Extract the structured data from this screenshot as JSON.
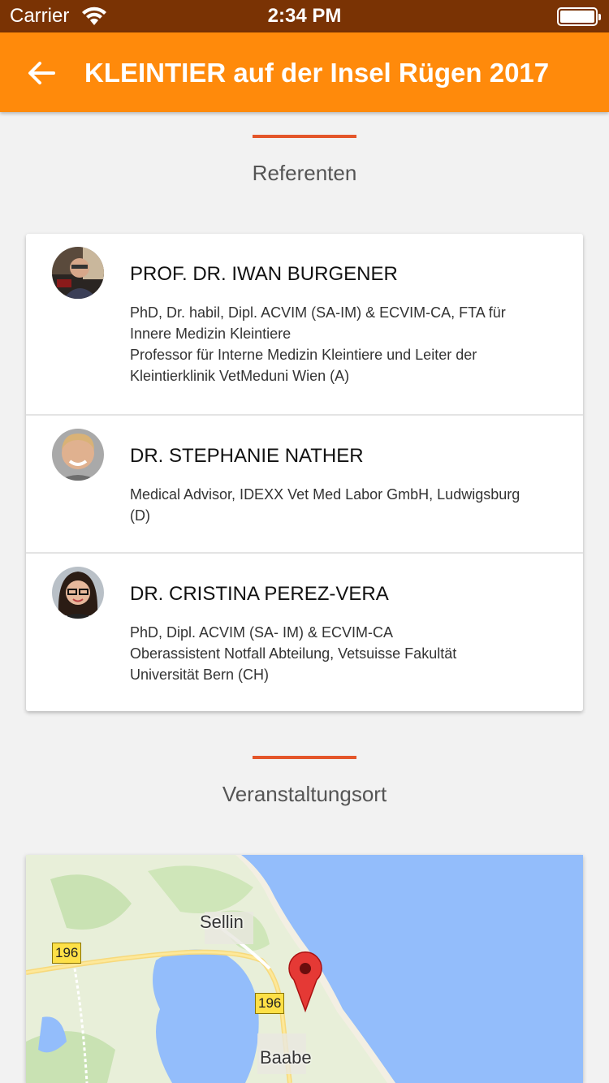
{
  "status_bar": {
    "carrier": "Carrier",
    "time": "2:34 PM"
  },
  "app_bar": {
    "title": "KLEINTIER auf der Insel Rügen 2017"
  },
  "colors": {
    "status_bar": "#7a3304",
    "app_bar": "#ff8a0b",
    "accent_rule": "#e4562a",
    "water": "#93bdfb"
  },
  "speakers_section": {
    "heading": "Referenten",
    "speakers": [
      {
        "name": "PROF. DR. IWAN BURGENER",
        "bio": "PhD, Dr. habil, Dipl. ACVIM (SA-IM) & ECVIM-CA, FTA für\nInnere Medizin Kleintiere\nProfessor für Interne Medizin Kleintiere und Leiter der\nKleintierklinik VetMeduni Wien (A)"
      },
      {
        "name": "DR. STEPHANIE NATHER",
        "bio": "Medical Advisor, IDEXX Vet Med Labor GmbH, Ludwigsburg\n(D)"
      },
      {
        "name": "DR. CRISTINA PEREZ-VERA",
        "bio": "PhD, Dipl. ACVIM (SA- IM) & ECVIM-CA\nOberassistent Notfall Abteilung, Vetsuisse Fakultät\nUniversität Bern (CH)"
      }
    ]
  },
  "venue_section": {
    "heading": "Veranstaltungsort",
    "map": {
      "places": [
        "Sellin",
        "Baabe"
      ],
      "road_labels": [
        "196",
        "196"
      ]
    }
  }
}
